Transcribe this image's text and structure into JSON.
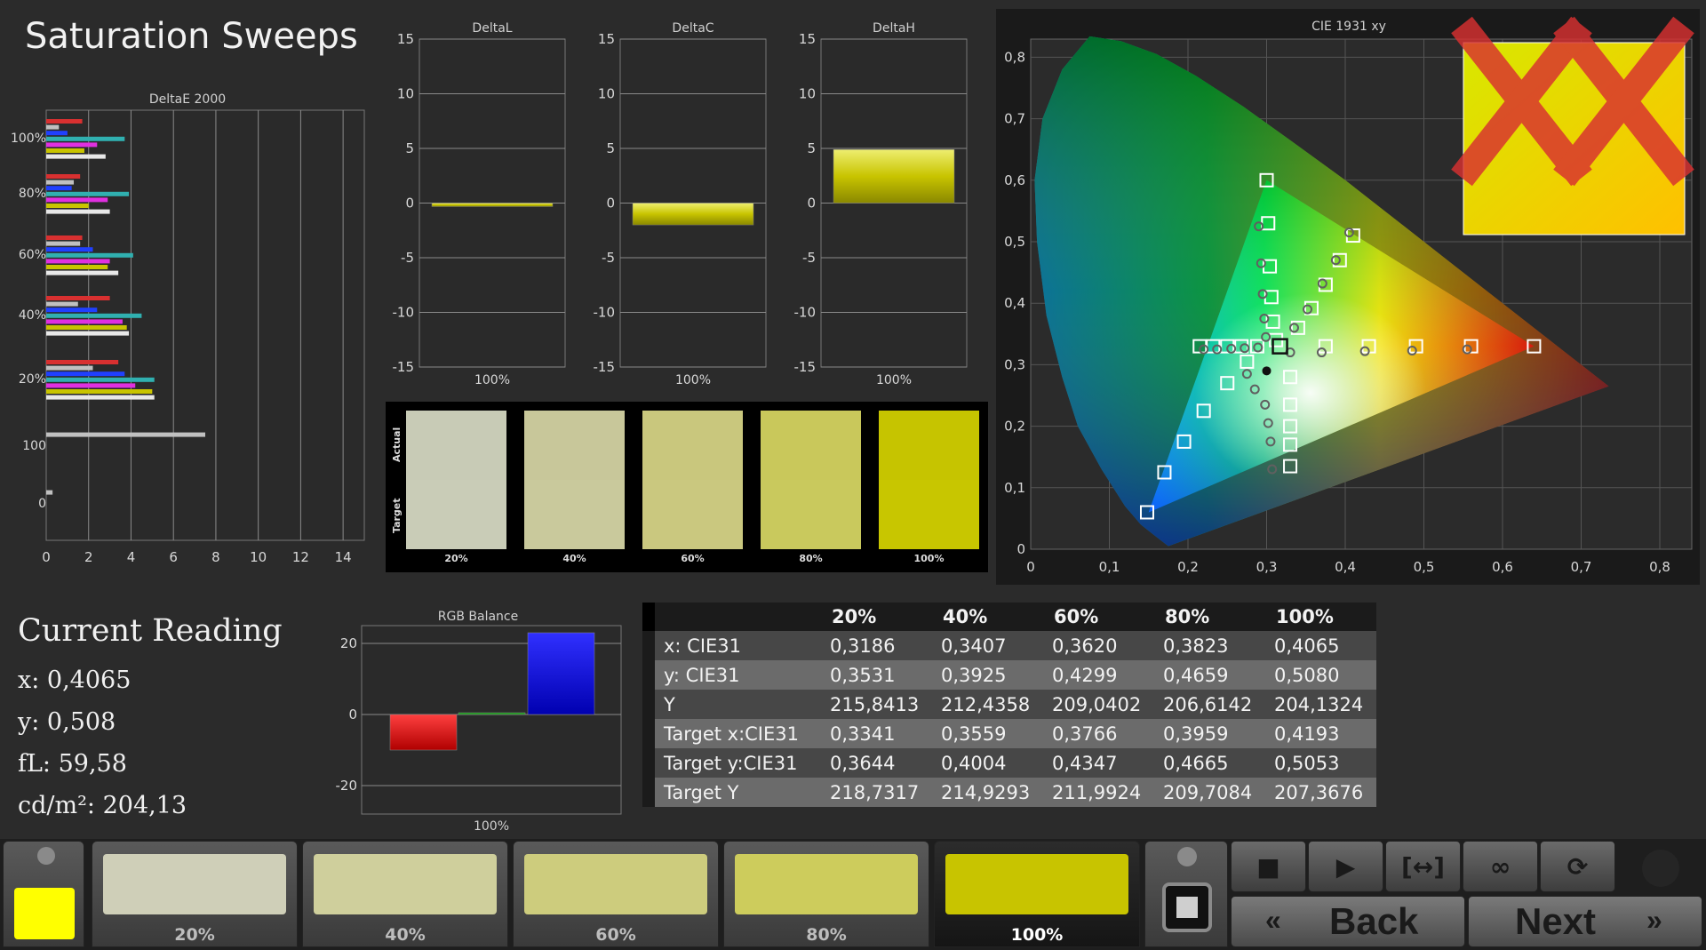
{
  "window": {
    "title": "Saturation Sweeps"
  },
  "colors": {
    "accent_yellow": "#c8c400",
    "red": "#e00000",
    "blue": "#1010f0",
    "green": "#00a000"
  },
  "deltae_chart": {
    "title": "DeltaE 2000",
    "y_labels": [
      "100%",
      "80%",
      "60%",
      "40%",
      "20%",
      "100",
      "0"
    ],
    "x_ticks": [
      "0",
      "2",
      "4",
      "6",
      "8",
      "10",
      "12",
      "14"
    ],
    "xlim": [
      0,
      15
    ]
  },
  "delta_charts": [
    {
      "title": "DeltaL",
      "category": "100%",
      "value": -0.3,
      "ylim": [
        -15,
        15
      ],
      "y_ticks": [
        "15",
        "10",
        "5",
        "0",
        "-5",
        "-10",
        "-15"
      ]
    },
    {
      "title": "DeltaC",
      "category": "100%",
      "value": -2.0,
      "ylim": [
        -15,
        15
      ],
      "y_ticks": [
        "15",
        "10",
        "5",
        "0",
        "-5",
        "-10",
        "-15"
      ]
    },
    {
      "title": "DeltaH",
      "category": "100%",
      "value": 4.9,
      "ylim": [
        -15,
        15
      ],
      "y_ticks": [
        "15",
        "10",
        "5",
        "0",
        "-5",
        "-10",
        "-15"
      ]
    }
  ],
  "swatch_panel": {
    "side_labels": [
      "Actual",
      "Target"
    ],
    "items": [
      {
        "label": "20%",
        "actual": "#c8cbb6",
        "target": "#c9ccb7"
      },
      {
        "label": "40%",
        "actual": "#c8c79a",
        "target": "#c9c99c"
      },
      {
        "label": "60%",
        "actual": "#c9c77d",
        "target": "#cac87f"
      },
      {
        "label": "80%",
        "actual": "#c9c85b",
        "target": "#c9c95d"
      },
      {
        "label": "100%",
        "actual": "#c6c400",
        "target": "#c8c600"
      }
    ]
  },
  "cie_chart": {
    "title": "CIE 1931 xy",
    "x_ticks": [
      "0",
      "0,1",
      "0,2",
      "0,3",
      "0,4",
      "0,5",
      "0,6",
      "0,7",
      "0,8"
    ],
    "y_ticks": [
      "0",
      "0,1",
      "0,2",
      "0,3",
      "0,4",
      "0,5",
      "0,6",
      "0,7",
      "0,8"
    ],
    "white_point": [
      0.3127,
      0.329
    ]
  },
  "current_reading": {
    "title": "Current Reading",
    "x": "x: 0,4065",
    "y": "y: 0,508",
    "fl": "fL: 59,58",
    "cdm2": "cd/m²: 204,13"
  },
  "rgb_balance": {
    "title": "RGB Balance",
    "category": "100%",
    "y_ticks": [
      "20",
      "0",
      "-20"
    ],
    "ylim": [
      -28,
      25
    ],
    "values": {
      "red": -10,
      "green": 0.5,
      "blue": 23
    }
  },
  "table": {
    "columns": [
      "20%",
      "40%",
      "60%",
      "80%",
      "100%"
    ],
    "rows": [
      {
        "label": "x: CIE31",
        "values": [
          "0,3186",
          "0,3407",
          "0,3620",
          "0,3823",
          "0,4065"
        ]
      },
      {
        "label": "y: CIE31",
        "values": [
          "0,3531",
          "0,3925",
          "0,4299",
          "0,4659",
          "0,5080"
        ]
      },
      {
        "label": "Y",
        "values": [
          "215,8413",
          "212,4358",
          "209,0402",
          "206,6142",
          "204,1324"
        ]
      },
      {
        "label": "Target x:CIE31",
        "values": [
          "0,3341",
          "0,3559",
          "0,3766",
          "0,3959",
          "0,4193"
        ]
      },
      {
        "label": "Target y:CIE31",
        "values": [
          "0,3644",
          "0,4004",
          "0,4347",
          "0,4665",
          "0,5053"
        ]
      },
      {
        "label": "Target Y",
        "values": [
          "218,7317",
          "214,9293",
          "211,9924",
          "209,7084",
          "207,3676"
        ]
      }
    ]
  },
  "bottom_tabs": [
    {
      "label": "20%",
      "color": "#cfcfb8"
    },
    {
      "label": "40%",
      "color": "#cfcf9c"
    },
    {
      "label": "60%",
      "color": "#cdcc7d"
    },
    {
      "label": "80%",
      "color": "#cdcc5c"
    },
    {
      "label": "100%",
      "color": "#c8c400"
    }
  ],
  "controls": {
    "selected_color": "#ffff00",
    "icons": [
      "stop-icon",
      "play-icon",
      "bracket-icon",
      "loop-icon",
      "refresh-icon"
    ],
    "back_label": "Back",
    "next_label": "Next"
  },
  "chart_data": [
    {
      "type": "bar",
      "title": "DeltaE 2000",
      "categories": [
        "100%",
        "80%",
        "60%",
        "40%",
        "20%",
        "100",
        "0"
      ],
      "series": [
        {
          "values": [
            1.7,
            1.6,
            1.7,
            3.0,
            3.4,
            0,
            0
          ]
        },
        {
          "values": [
            0.6,
            1.3,
            1.6,
            1.5,
            2.2,
            7.5,
            0.3
          ]
        },
        {
          "values": [
            1.0,
            1.2,
            2.2,
            2.4,
            3.7,
            0,
            0
          ]
        },
        {
          "values": [
            3.7,
            3.9,
            4.1,
            4.5,
            5.1,
            0,
            0
          ]
        },
        {
          "values": [
            2.4,
            2.9,
            3.0,
            3.6,
            4.2,
            0,
            0
          ]
        },
        {
          "values": [
            1.8,
            2.0,
            2.9,
            3.8,
            5.0,
            0,
            0
          ]
        },
        {
          "values": [
            2.8,
            3.0,
            3.4,
            3.9,
            5.1,
            0,
            0
          ]
        }
      ],
      "series_colors": [
        "#d83030",
        "#c0c0c0",
        "#2040ff",
        "#30b0b0",
        "#e030e0",
        "#c8c400",
        "#e8e8e8"
      ],
      "xlim": [
        0,
        15
      ]
    },
    {
      "type": "scatter",
      "title": "CIE 1931 xy",
      "xlim": [
        0,
        0.8
      ],
      "ylim": [
        0,
        0.8
      ],
      "target_points": [
        [
          0.148,
          0.06
        ],
        [
          0.17,
          0.125
        ],
        [
          0.195,
          0.175
        ],
        [
          0.22,
          0.225
        ],
        [
          0.25,
          0.27
        ],
        [
          0.275,
          0.305
        ],
        [
          0.3,
          0.6
        ],
        [
          0.302,
          0.53
        ],
        [
          0.304,
          0.46
        ],
        [
          0.306,
          0.41
        ],
        [
          0.308,
          0.37
        ],
        [
          0.312,
          0.34
        ],
        [
          0.64,
          0.33
        ],
        [
          0.56,
          0.33
        ],
        [
          0.49,
          0.33
        ],
        [
          0.43,
          0.33
        ],
        [
          0.375,
          0.33
        ],
        [
          0.215,
          0.33
        ],
        [
          0.232,
          0.33
        ],
        [
          0.25,
          0.33
        ],
        [
          0.268,
          0.33
        ],
        [
          0.288,
          0.33
        ],
        [
          0.41,
          0.51
        ],
        [
          0.393,
          0.47
        ],
        [
          0.375,
          0.43
        ],
        [
          0.357,
          0.392
        ],
        [
          0.34,
          0.36
        ],
        [
          0.33,
          0.28
        ],
        [
          0.33,
          0.235
        ],
        [
          0.33,
          0.2
        ],
        [
          0.33,
          0.17
        ],
        [
          0.33,
          0.135
        ]
      ],
      "measured_points": [
        [
          0.29,
          0.525
        ],
        [
          0.293,
          0.465
        ],
        [
          0.295,
          0.415
        ],
        [
          0.297,
          0.375
        ],
        [
          0.299,
          0.345
        ],
        [
          0.405,
          0.515
        ],
        [
          0.388,
          0.47
        ],
        [
          0.371,
          0.432
        ],
        [
          0.352,
          0.39
        ],
        [
          0.335,
          0.36
        ],
        [
          0.555,
          0.325
        ],
        [
          0.485,
          0.323
        ],
        [
          0.425,
          0.322
        ],
        [
          0.37,
          0.32
        ],
        [
          0.33,
          0.32
        ],
        [
          0.22,
          0.325
        ],
        [
          0.237,
          0.325
        ],
        [
          0.255,
          0.326
        ],
        [
          0.272,
          0.327
        ],
        [
          0.289,
          0.328
        ],
        [
          0.275,
          0.285
        ],
        [
          0.285,
          0.26
        ],
        [
          0.298,
          0.235
        ],
        [
          0.302,
          0.205
        ],
        [
          0.305,
          0.175
        ],
        [
          0.307,
          0.13
        ]
      ],
      "current_point": [
        0.4065,
        0.508
      ],
      "highlight": [
        0.317,
        0.33
      ]
    }
  ]
}
